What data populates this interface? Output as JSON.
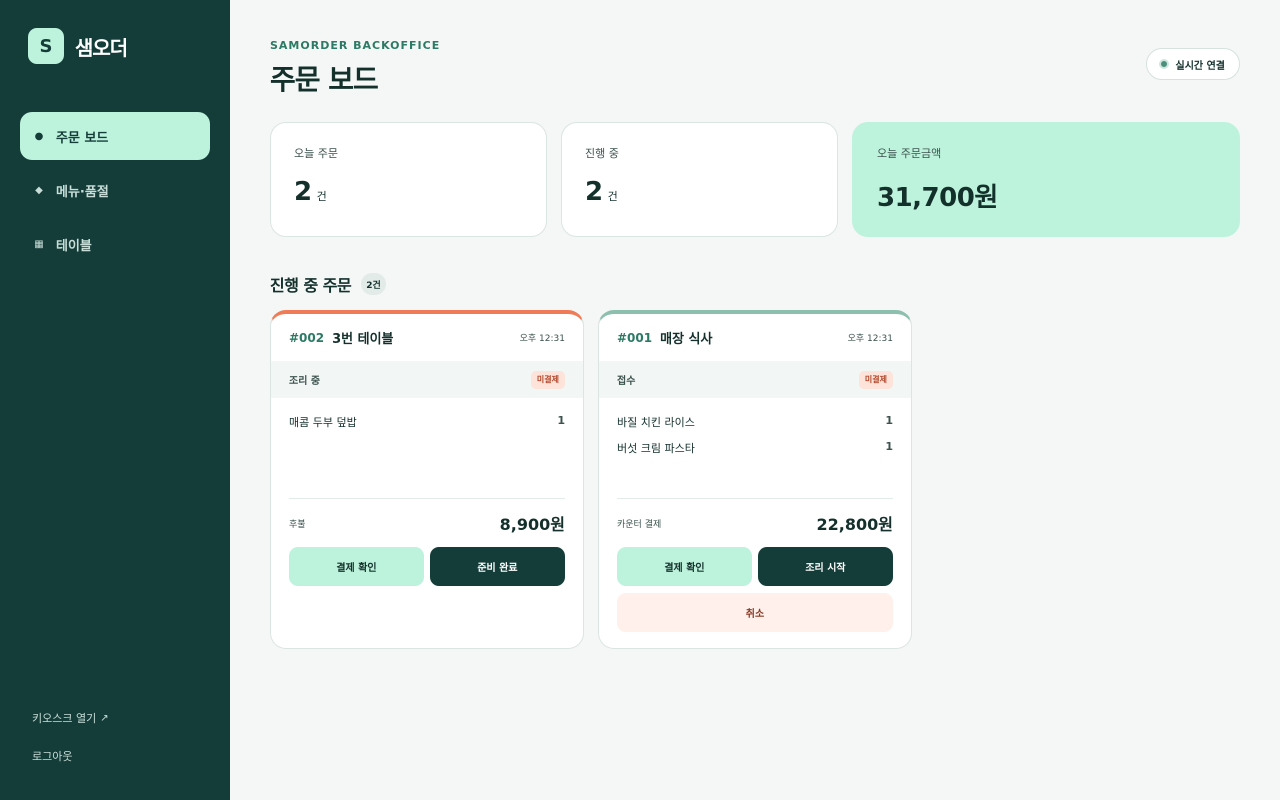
{
  "brand": {
    "logo_letter": "S",
    "name": "샘오더"
  },
  "sidebar": {
    "items": [
      {
        "label": "주문 보드",
        "icon": "dot-icon",
        "glyph": "●",
        "active": true
      },
      {
        "label": "메뉴·품절",
        "icon": "diamond-icon",
        "glyph": "◆",
        "active": false
      },
      {
        "label": "테이블",
        "icon": "grid-icon",
        "glyph": "▦",
        "active": false
      }
    ],
    "kiosk_link": "키오스크 열기",
    "kiosk_arrow": "↗",
    "logout": "로그아웃"
  },
  "header": {
    "eyebrow": "SAMORDER BACKOFFICE",
    "title": "주문 보드",
    "live_status": "실시간 연결"
  },
  "stats": [
    {
      "label": "오늘 주문",
      "value": "2",
      "unit": "건"
    },
    {
      "label": "진행 중",
      "value": "2",
      "unit": "건"
    },
    {
      "label": "오늘 주문금액",
      "value": "31,700원",
      "unit": ""
    }
  ],
  "section": {
    "title": "진행 중 주문",
    "count": "2건"
  },
  "orders": [
    {
      "number": "#002",
      "name": "3번 테이블",
      "time": "오후 12:31",
      "status": "조리 중",
      "payment_badge": "미결제",
      "accent": "#f07b57",
      "items": [
        {
          "name": "매콤 두부 덮밥",
          "qty": "1"
        }
      ],
      "pay_method": "후불",
      "total": "8,900원",
      "btn_confirm": "결제 확인",
      "btn_next": "준비 완료"
    },
    {
      "number": "#001",
      "name": "매장 식사",
      "time": "오후 12:31",
      "status": "접수",
      "payment_badge": "미결제",
      "accent": "#8dbfae",
      "items": [
        {
          "name": "바질 치킨 라이스",
          "qty": "1"
        },
        {
          "name": "버섯 크림 파스타",
          "qty": "1"
        }
      ],
      "pay_method": "카운터 결제",
      "total": "22,800원",
      "btn_confirm": "결제 확인",
      "btn_next": "조리 시작",
      "btn_cancel": "취소"
    }
  ],
  "colors": {
    "sidebar_bg": "#143c38",
    "accent_mint": "#bdf3dc",
    "primary_dark": "#143c38",
    "unpaid_bg": "#fde3da"
  }
}
